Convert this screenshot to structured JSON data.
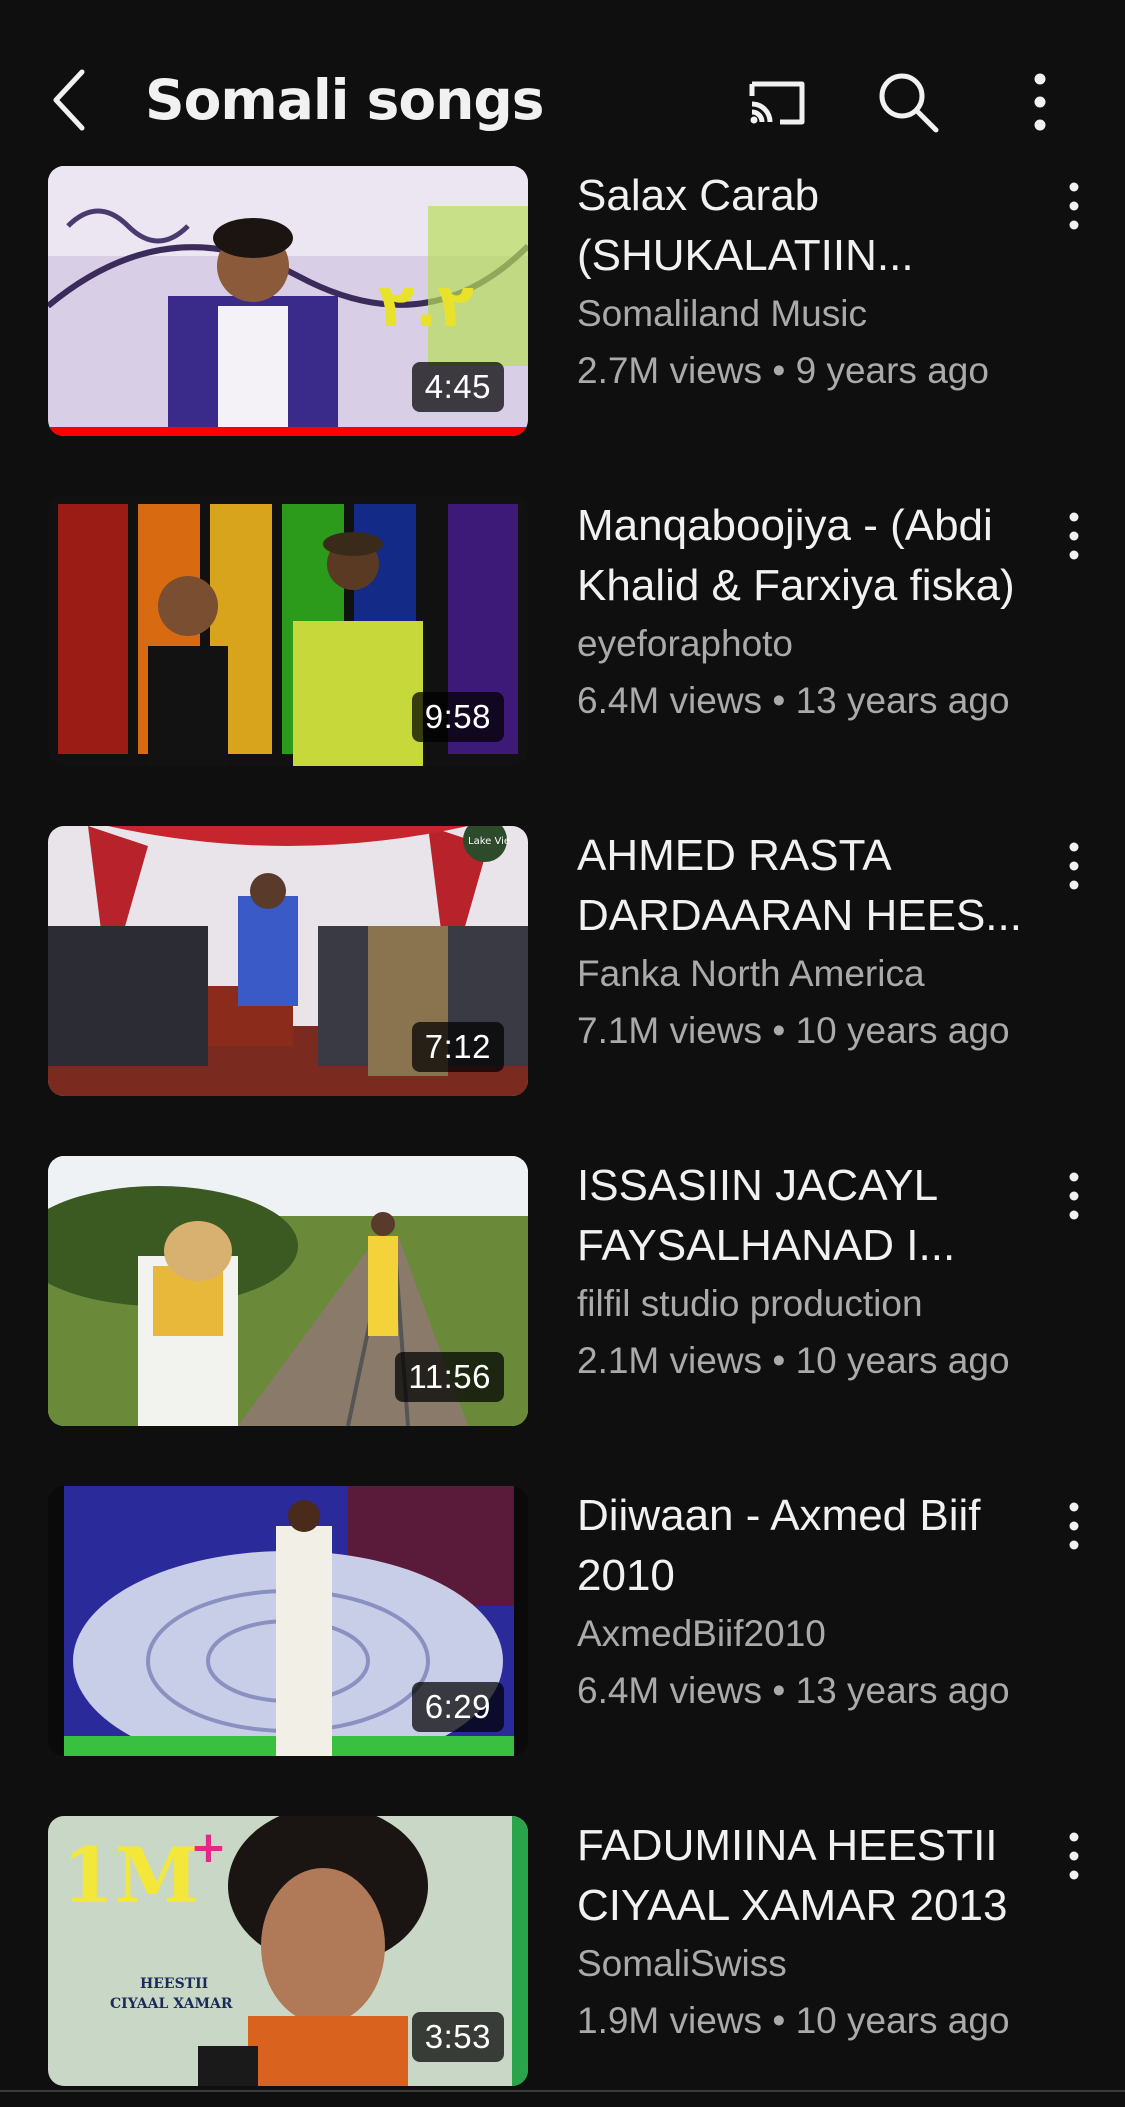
{
  "header": {
    "title": "Somali songs",
    "icons": [
      "back-arrow-icon",
      "cast-icon",
      "search-icon",
      "more-vertical-icon"
    ]
  },
  "videos": [
    {
      "title": "Salax Carab (SHUKALATIIN...",
      "channel": "Somaliland Music",
      "views": "2.7M views",
      "age": "9 years ago",
      "duration": "4:45",
      "watched_fraction": 1.0
    },
    {
      "title": "Manqaboojiya - (Abdi Khalid & Farxiya fiska)",
      "channel": "eyeforaphoto",
      "views": "6.4M views",
      "age": "13 years ago",
      "duration": "9:58"
    },
    {
      "title": "AHMED RASTA DARDAARAN HEES...",
      "channel": "Fanka North America",
      "views": "7.1M views",
      "age": "10 years ago",
      "duration": "7:12",
      "thumb_text": "Lake Vie"
    },
    {
      "title": "ISSASIIN JACAYL FAYSALHANAD I...",
      "channel": "filfil studio production",
      "views": "2.1M views",
      "age": "10 years ago",
      "duration": "11:56"
    },
    {
      "title": "Diiwaan - Axmed Biif 2010",
      "channel": "AxmedBiif2010",
      "views": "6.4M views",
      "age": "13 years ago",
      "duration": "6:29"
    },
    {
      "title": "FADUMIINA HEESTII CIYAAL XAMAR 2013",
      "channel": "SomaliSwiss",
      "views": "1.9M views",
      "age": "10 years ago",
      "duration": "3:53",
      "thumb_text": {
        "big": "1M",
        "plus": "+",
        "line1": "HEESTII",
        "line2": "CIYAAL XAMAR"
      }
    }
  ],
  "separator": "•",
  "colors": {
    "background": "#0f0f0f",
    "text": "#f1f1f1",
    "secondary_text": "#aaaaaa",
    "progress": "#ff0000"
  }
}
